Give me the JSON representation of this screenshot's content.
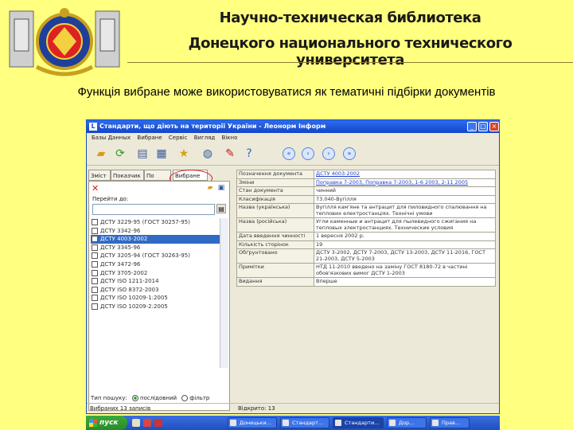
{
  "header": {
    "title_line1": "Научно-техническая библиотека",
    "title_line2": "Донецкого национального технического университета",
    "caption": "Функція вибране може використовуватися як тематичні підбірки документів"
  },
  "window": {
    "title": "Стандарти, що діють на території України - Леонорм Інформ",
    "app_icon": "L",
    "menu": [
      "Базы Данных",
      "Вибране",
      "Сервіс",
      "Вигляд",
      "Вікно"
    ],
    "tabs": [
      "Зміст",
      "Показчик",
      "По",
      "Вибране"
    ],
    "goto_label": "Перейти до:",
    "list_items": [
      "ДСТУ 3229-95 (ГОСТ 30257-95)",
      "ДСТУ 3342-96",
      "ДСТУ 4003-2002",
      "ДСТУ 3345-96",
      "ДСТУ 3205-94 (ГОСТ 30263-95)",
      "ДСТУ 3472-96",
      "ДСТУ 3705-2002",
      "ДСТУ ISO 1211-2014",
      "ДСТУ ISO 8372-2003",
      "ДСТУ ISO 10209-1:2005",
      "ДСТУ ISO 10209-2:2005"
    ],
    "selected_index": 2,
    "filter_label": "Тип пошуку:",
    "filter_options": [
      "послідовний",
      "фільтр"
    ],
    "status_left": "Вибраних 13 записів",
    "status_right": "Відкрито: 13",
    "properties": [
      {
        "k": "Позначення документа",
        "v": "ДСТУ 4003-2002",
        "link": true
      },
      {
        "k": "Зміни",
        "v": "Поправка 7-2003, Поправка 7-2003, 1-6 2003, 2-11 2005",
        "link": true
      },
      {
        "k": "Стан документа",
        "v": "чинний",
        "link": false
      },
      {
        "k": "Класифікація",
        "v": "73.040-Вугілля",
        "link": false
      },
      {
        "k": "Назва (українська)",
        "v": "Вугілля кам'яне та антрацит для пиловидного спалювання на теплових електростанціях. Технічні умови",
        "link": false
      },
      {
        "k": "Назва (російська)",
        "v": "Угли каменные и антрацит для пылевидного сжигания на тепловых электростанциях. Технические условия",
        "link": false
      },
      {
        "k": "Дата введення чинності",
        "v": "1 вересня 2002 р.",
        "link": false
      },
      {
        "k": "Кількість сторінок",
        "v": "19",
        "link": false
      },
      {
        "k": "Обґрунтовано",
        "v": "ДСТУ 3-2002, ДСТУ 7-2003, ДСТУ 13-2003, ДСТУ 11-2016, ГОСТ 21-2003, ДСТУ 5-2003",
        "link": false
      },
      {
        "k": "Примітки",
        "v": "НТД 11-2010 введено на заміну ГОСТ 8180-72 в частині обов'язкових вимог ДСТУ 1-2003",
        "link": false
      },
      {
        "k": "Видання",
        "v": "Вперше",
        "link": false
      }
    ]
  },
  "taskbar": {
    "start_label": "пуск",
    "tasks": [
      "Донецьки...",
      "Стандарт...",
      "Стандарти...",
      "Дор...",
      "Прав..."
    ]
  }
}
